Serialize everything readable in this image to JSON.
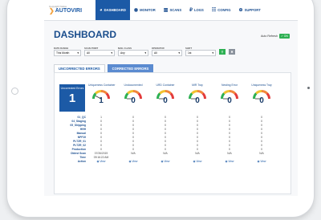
{
  "app": {
    "tagline": "Copyright Notice",
    "name": "AUTOVIRI"
  },
  "nav": [
    {
      "label": "DASHBOARD",
      "icon": "dashboard-icon",
      "active": true
    },
    {
      "label": "MONITOR",
      "icon": "eye-icon"
    },
    {
      "label": "SCANS",
      "icon": "scans-icon"
    },
    {
      "label": "LOGS",
      "icon": "logs-icon"
    },
    {
      "label": "CONFIG",
      "icon": "sliders-icon"
    },
    {
      "label": "SUPPORT",
      "icon": "lifebuoy-icon"
    }
  ],
  "page": {
    "title": "DASHBOARD",
    "auto_refresh_label": "Auto Refresh",
    "auto_refresh_state": "✓ ON"
  },
  "filters": [
    {
      "label": "DATE RANGE",
      "value": "This Month"
    },
    {
      "label": "SCAN POINT",
      "value": "All"
    },
    {
      "label": "MAIL CLASS",
      "value": "Any"
    },
    {
      "label": "OPERATOR",
      "value": "All"
    },
    {
      "label": "SHIFT",
      "value": "1st"
    }
  ],
  "tabs": [
    "UNCORRECTED ERRORS",
    "CORRECTED ERRORS"
  ],
  "summary": {
    "label": "Uncorrected Errors",
    "value": "1"
  },
  "gauges": [
    {
      "title": "Uniqueness Container",
      "value": "1",
      "level": 0.15
    },
    {
      "title": "Undocumented",
      "value": "0",
      "level": 0
    },
    {
      "title": "URD Container",
      "value": "0",
      "level": 0
    },
    {
      "title": "MIR Tray",
      "value": "0",
      "level": 0
    },
    {
      "title": "Nesting Error",
      "value": "0",
      "level": 0
    },
    {
      "title": "Uniqueness Tray",
      "value": "0",
      "level": 0
    }
  ],
  "row_labels": [
    "01_QC",
    "04_Staging",
    "05_Shipping",
    "HHH",
    "Manual",
    "NPF19",
    "PLTZR_01",
    "PLTZR_02",
    "Production",
    "Oldest Scan",
    "Time",
    "Action"
  ],
  "columns": [
    [
      "1",
      "0",
      "0",
      "0",
      "0",
      "0",
      "0",
      "0",
      "0",
      "07/26/2019",
      "09:16:22 AM",
      "View"
    ],
    [
      "0",
      "0",
      "0",
      "0",
      "0",
      "0",
      "0",
      "0",
      "0",
      "N/A",
      "",
      "View"
    ],
    [
      "0",
      "0",
      "0",
      "0",
      "0",
      "0",
      "0",
      "0",
      "0",
      "N/A",
      "",
      "View"
    ],
    [
      "0",
      "0",
      "0",
      "0",
      "0",
      "0",
      "0",
      "0",
      "0",
      "N/A",
      "",
      "View"
    ],
    [
      "0",
      "0",
      "0",
      "0",
      "0",
      "0",
      "0",
      "0",
      "0",
      "N/A",
      "",
      "View"
    ],
    [
      "0",
      "0",
      "0",
      "0",
      "0",
      "0",
      "0",
      "0",
      "0",
      "N/A",
      "",
      "View"
    ]
  ]
}
